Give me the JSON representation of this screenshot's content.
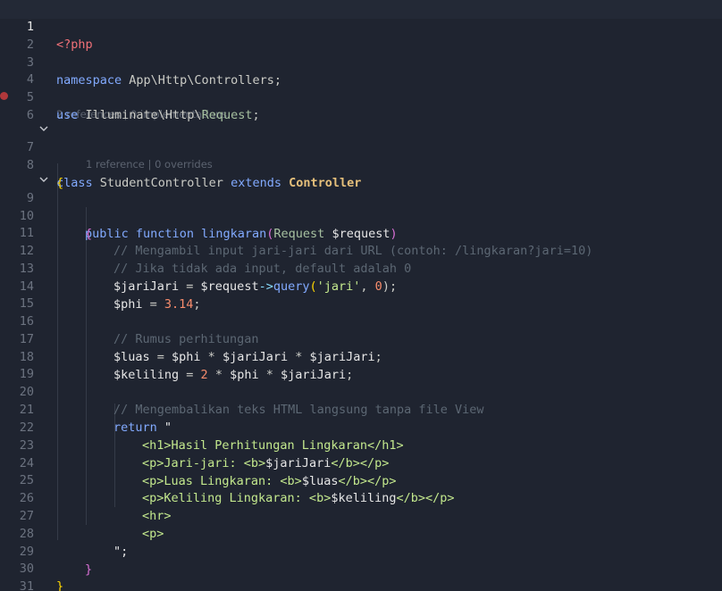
{
  "editor": {
    "language": "php",
    "active_line": 1,
    "breakpoint_line": 6,
    "codelens": {
      "class_refs": "2 references | 0 implementations",
      "method_refs": "1 reference | 0 overrides"
    },
    "line_numbers": [
      "1",
      "2",
      "3",
      "4",
      "5",
      "6",
      "7",
      "8",
      "9",
      "10",
      "11",
      "12",
      "13",
      "14",
      "15",
      "16",
      "17",
      "18",
      "19",
      "20",
      "21",
      "22",
      "23",
      "24",
      "25",
      "26",
      "27",
      "28",
      "29",
      "30",
      "31"
    ],
    "tokens": {
      "l1": [
        "<?php"
      ],
      "l3": [
        "namespace",
        " App\\Http\\Controllers;"
      ],
      "l5": [
        "use",
        " Illuminate\\Http\\",
        "Request",
        ";"
      ],
      "l7": [
        "class",
        " StudentController ",
        "extends",
        " ",
        "Controller"
      ],
      "l8": [
        "{"
      ],
      "l9": [
        "public",
        " ",
        "function",
        " ",
        "lingkaran",
        "(",
        "Request",
        " ",
        "$request",
        ")"
      ],
      "l10": [
        "{"
      ],
      "l11": [
        "// Mengambil input jari-jari dari URL (contoh: /lingkaran?jari=10)"
      ],
      "l12": [
        "// Jika tidak ada input, default adalah 0"
      ],
      "l13": [
        "$jariJari",
        " = ",
        "$request",
        "->",
        "query",
        "(",
        "'jari'",
        ", ",
        "0",
        ");"
      ],
      "l14": [
        "$phi",
        " = ",
        "3.14",
        ";"
      ],
      "l16": [
        "// Rumus perhitungan"
      ],
      "l17": [
        "$luas",
        " = ",
        "$phi",
        " * ",
        "$jariJari",
        " * ",
        "$jariJari",
        ";"
      ],
      "l18": [
        "$keliling",
        " = ",
        "2",
        " * ",
        "$phi",
        " * ",
        "$jariJari",
        ";"
      ],
      "l20": [
        "// Mengembalikan teks HTML langsung tanpa file View"
      ],
      "l21": [
        "return",
        " \""
      ],
      "l22": [
        "<h1>Hasil Perhitungan Lingkaran</h1>"
      ],
      "l23": [
        "<p>Jari-jari: <b>",
        "$jariJari",
        "</b></p>"
      ],
      "l24": [
        "<p>Luas Lingkaran: <b>",
        "$luas",
        "</b></p>"
      ],
      "l25": [
        "<p>Keliling Lingkaran: <b>",
        "$keliling",
        "</b></p>"
      ],
      "l26": [
        "<hr>"
      ],
      "l27": [
        "<p>"
      ],
      "l28": [
        "\";"
      ],
      "l29": [
        "}"
      ],
      "l30": [
        "}"
      ]
    },
    "folds": [
      "chevron-down-icon",
      "chevron-down-icon"
    ]
  }
}
